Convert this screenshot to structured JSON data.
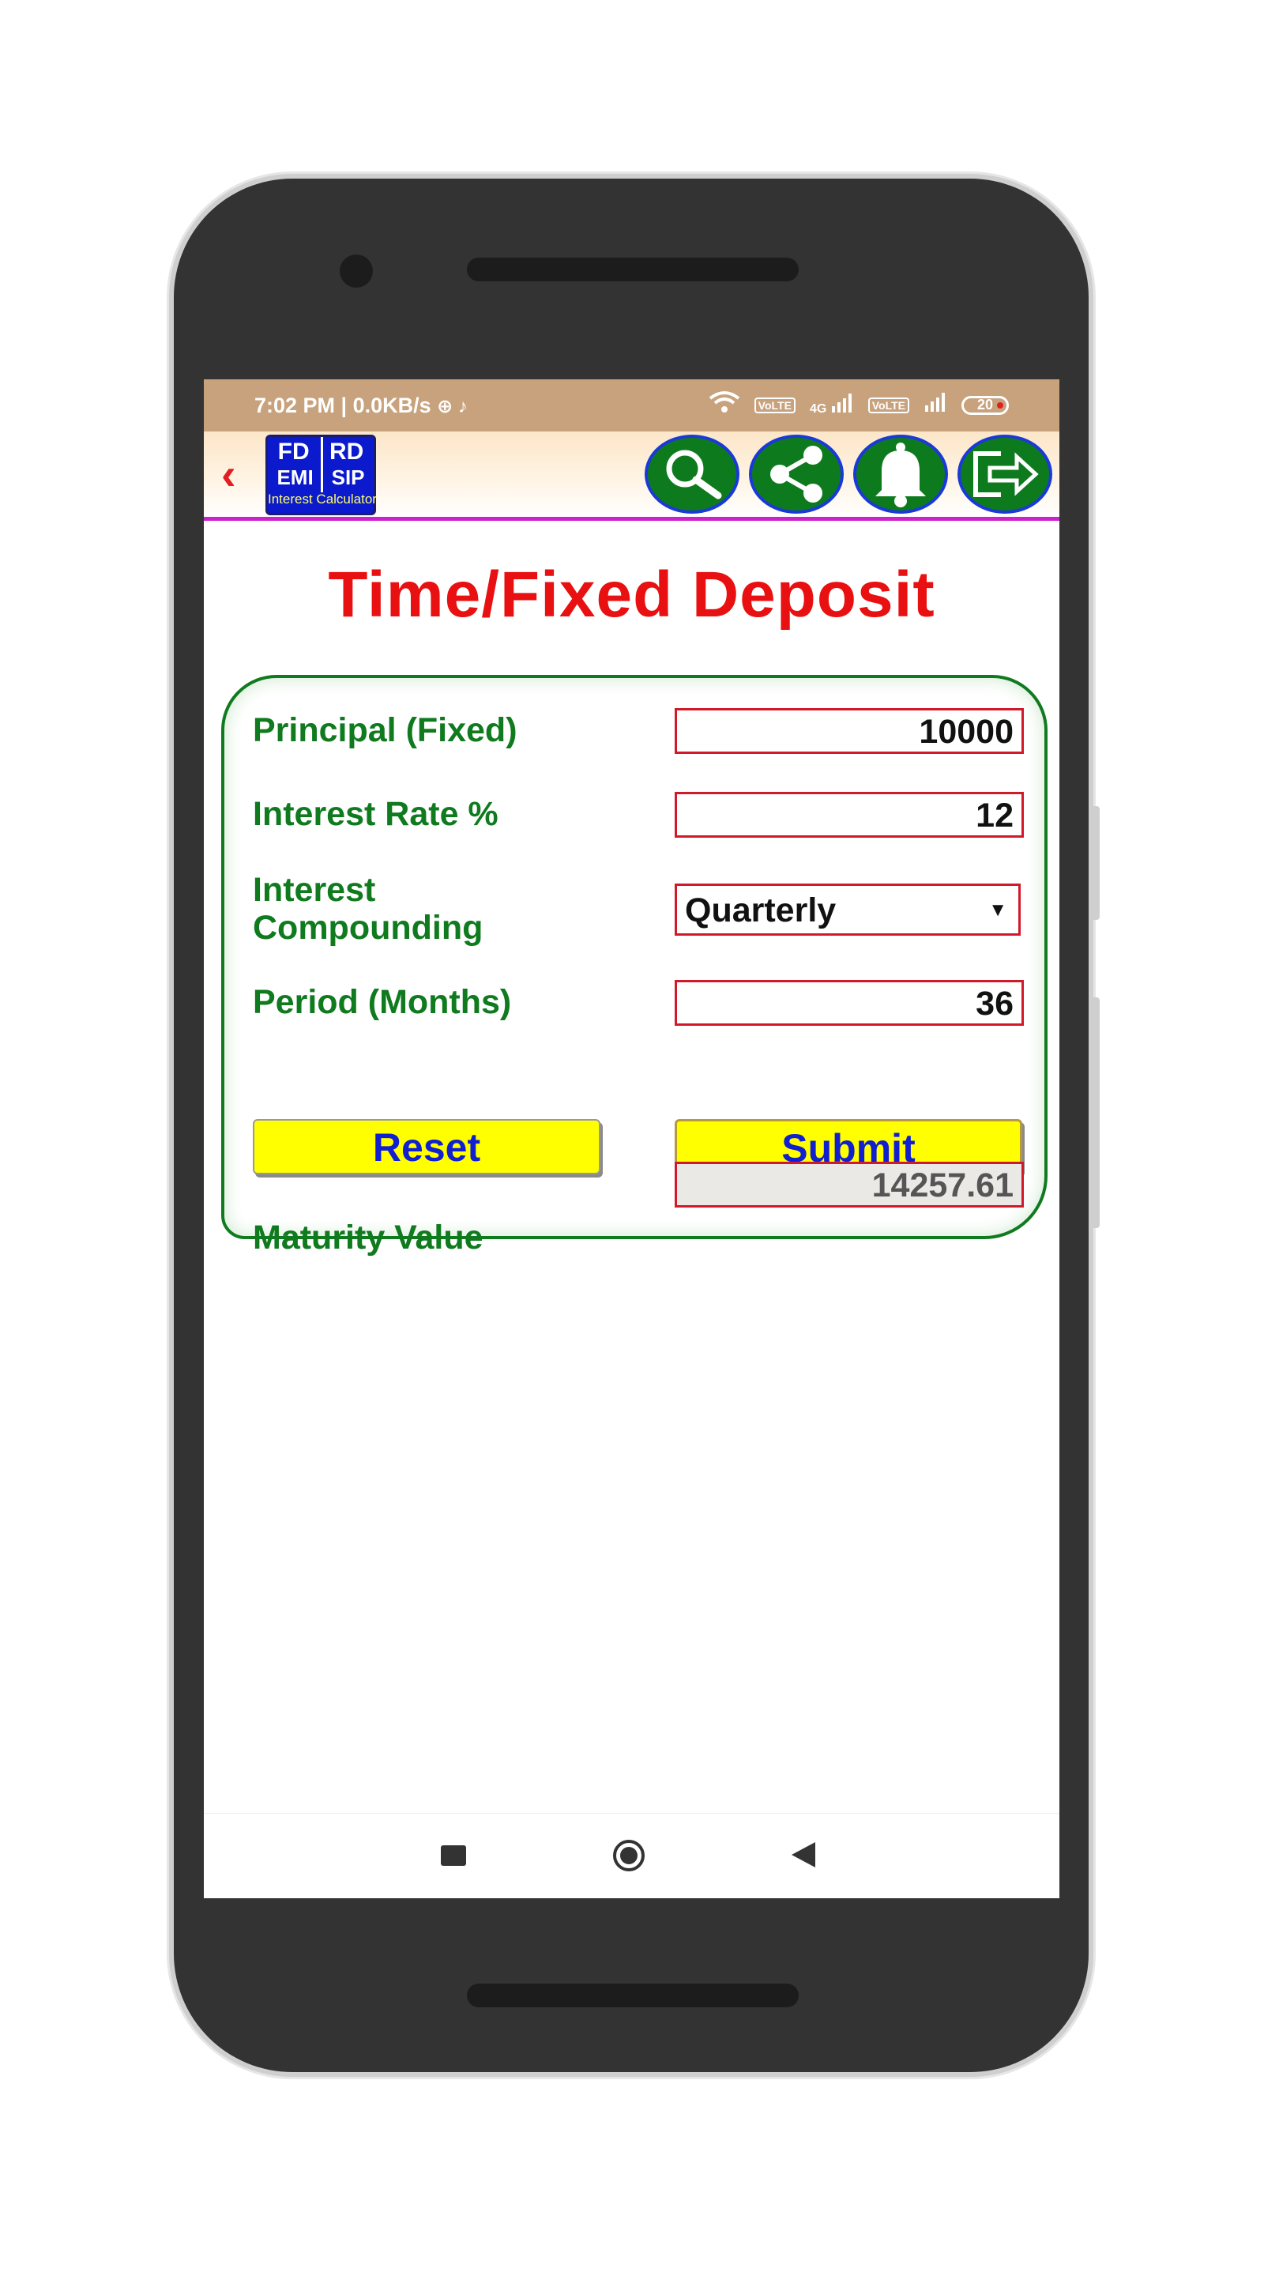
{
  "status_bar": {
    "time_text": "7:02 PM | 0.0KB/s",
    "battery": "20",
    "volte1": "VoLTE",
    "volte2": "VoLTE",
    "net4g": "4G"
  },
  "app_bar": {
    "back_icon": "chevron-left-icon",
    "logo": {
      "fd": "FD",
      "rd": "RD",
      "emi": "EMI",
      "sip": "SIP",
      "caption": "Interest Calculator"
    },
    "actions": [
      "search-icon",
      "share-icon",
      "bell-icon",
      "exit-icon"
    ]
  },
  "page": {
    "title": "Time/Fixed Deposit"
  },
  "form": {
    "principal": {
      "label": "Principal (Fixed)",
      "value": "10000"
    },
    "rate": {
      "label": "Interest Rate %",
      "value": "12"
    },
    "compounding": {
      "label_line1": "Interest",
      "label_line2": "Compounding",
      "value": "Quarterly"
    },
    "period": {
      "label": "Period (Months)",
      "value": "36"
    },
    "reset_label": "Reset",
    "submit_label": "Submit",
    "maturity": {
      "label": "Maturity Value",
      "value": "14257.61"
    }
  },
  "colors": {
    "status_bar": "#c8a27c",
    "title": "#e81010",
    "label": "#0f7a1e",
    "button_bg": "#ffff00",
    "button_text": "#1020d0",
    "field_border": "#d01a2a",
    "appbar_divider": "#cc22cc"
  }
}
